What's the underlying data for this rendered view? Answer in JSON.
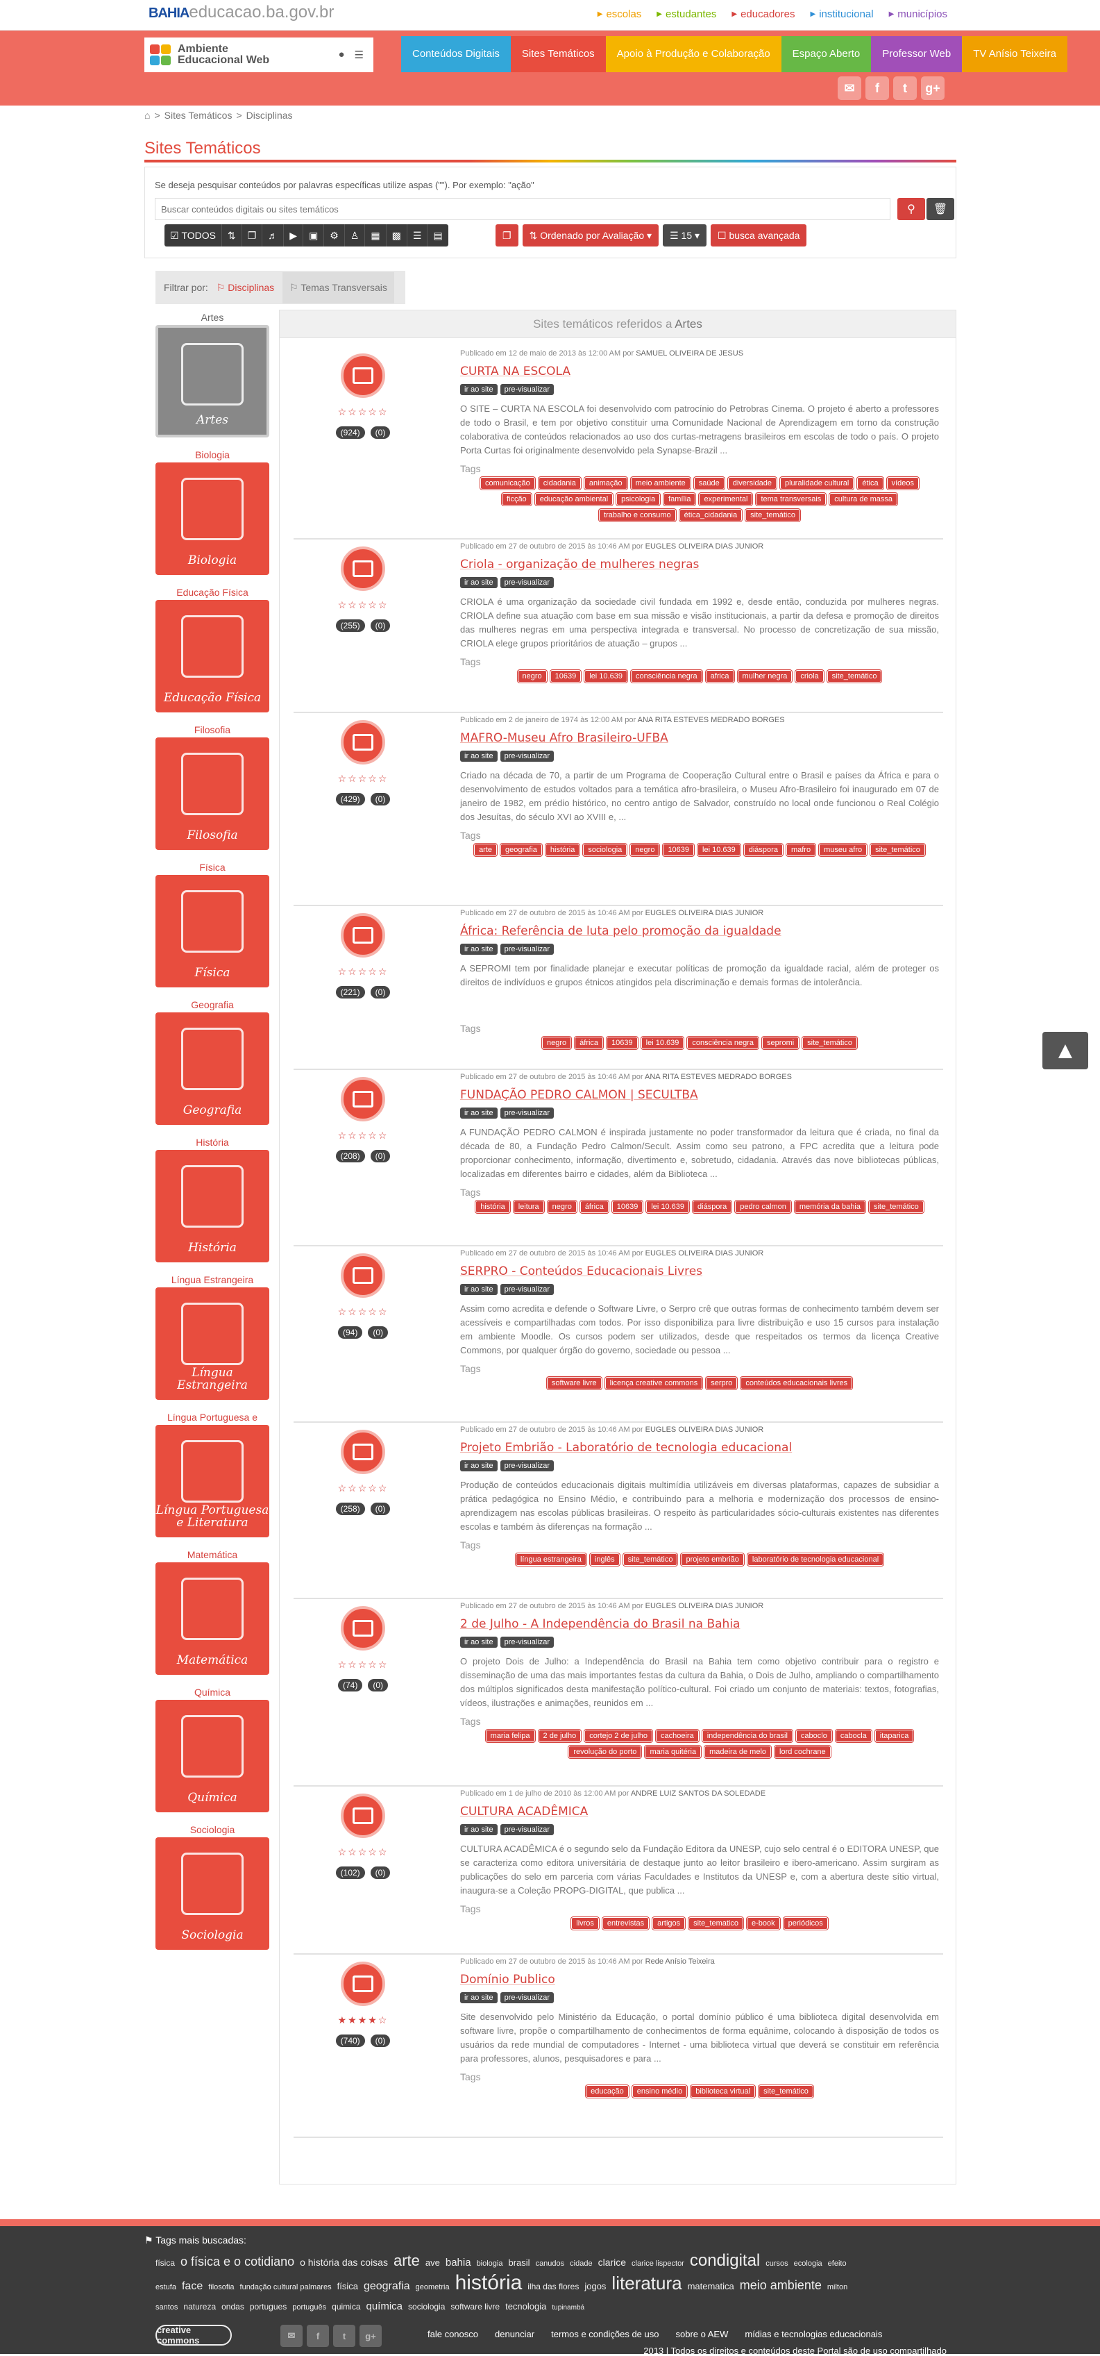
{
  "top": {
    "logo_bahia": "BAHIA",
    "logo_domain": "educacao.ba.gov.br",
    "links": [
      {
        "label": "escolas",
        "color": "#f0a000"
      },
      {
        "label": "estudantes",
        "color": "#7cb800"
      },
      {
        "label": "educadores",
        "color": "#d6423d"
      },
      {
        "label": "institucional",
        "color": "#2f8fd6"
      },
      {
        "label": "municípios",
        "color": "#8c52b8"
      }
    ]
  },
  "header": {
    "brand_line1": "Ambiente",
    "brand_line2": "Educacional Web",
    "nav": [
      {
        "label": "Conteúdos Digitais",
        "color": "#33a7d9"
      },
      {
        "label": "Sites Temáticos",
        "color": "#e84d3e"
      },
      {
        "label": "Apoio à Produção e Colaboração",
        "color": "#f5b400"
      },
      {
        "label": "Espaço Aberto",
        "color": "#67b846"
      },
      {
        "label": "Professor Web",
        "color": "#a14fb8"
      },
      {
        "label": "TV Anísio Teixeira",
        "color": "#f0a000"
      }
    ],
    "socials": [
      "✉",
      "f",
      "t",
      "g+"
    ]
  },
  "breadcrumb": [
    "⌂",
    ">",
    "Sites Temáticos",
    ">",
    "Disciplinas"
  ],
  "page_title": "Sites Temáticos",
  "search": {
    "hint": "Se deseja pesquisar conteúdos por palavras específicas utilize aspas (\"\"). Por exemplo: \"ação\"",
    "placeholder": "Buscar conteúdos digitais ou sites temáticos",
    "types_all": "TODOS",
    "order_label": "Ordenado por Avaliação",
    "per_page": "15",
    "advanced": "busca avançada"
  },
  "filter": {
    "label": "Filtrar por:",
    "opt1": "Disciplinas",
    "opt2": "Temas Transversais"
  },
  "subjects": [
    {
      "label": "Artes",
      "card": "Artes"
    },
    {
      "label": "Biologia",
      "card": "Biologia"
    },
    {
      "label": "Educação Física",
      "card": "Educação Física"
    },
    {
      "label": "Filosofia",
      "card": "Filosofia"
    },
    {
      "label": "Física",
      "card": "Física"
    },
    {
      "label": "Geografia",
      "card": "Geografia"
    },
    {
      "label": "História",
      "card": "História"
    },
    {
      "label": "Língua Estrangeira",
      "card": "Língua Estrangeira"
    },
    {
      "label": "Língua Portuguesa e Literatura",
      "card": "Língua Portuguesa e Literatura"
    },
    {
      "label": "Matemática",
      "card": "Matemática"
    },
    {
      "label": "Química",
      "card": "Química"
    },
    {
      "label": "Sociologia",
      "card": "Sociologia"
    }
  ],
  "content_head": {
    "prefix": "Sites temáticos referidos a",
    "subject": "Artes"
  },
  "buttons": {
    "site": "ir ao site",
    "preview": "pre-visualizar",
    "tags": "Tags"
  },
  "items": [
    {
      "meta": "Publicado em 12 de maio de 2013 às 12:00 AM por",
      "author": "SAMUEL OLIVEIRA DE JESUS",
      "title": "CURTA NA ESCOLA",
      "stars": "☆☆☆☆☆",
      "views": "(924)",
      "comments": "(0)",
      "desc": "O SITE – CURTA NA ESCOLA foi desenvolvido com patrocínio do Petrobras Cinema. O projeto é aberto a professores de todo o Brasil, e tem por objetivo constituir uma Comunidade Nacional de Aprendizagem em torno da construção colaborativa de conteúdos relacionados ao uso dos curtas-metragens brasileiros em escolas de todo o país. O projeto Porta Curtas foi originalmente desenvolvido pela Synapse-Brazil ...",
      "tags": [
        "comunicação",
        "cidadania",
        "animação",
        "meio ambiente",
        "saúde",
        "diversidade",
        "pluralidade cultural",
        "ética",
        "vídeos",
        "ficção",
        "educação ambiental",
        "psicologia",
        "família",
        "experimental",
        "tema transversais",
        "cultura de massa",
        "trabalho e consumo",
        "ética_cidadania",
        "site_temático"
      ]
    },
    {
      "meta": "Publicado em 27 de outubro de 2015 às 10:46 AM por",
      "author": "EUGLES OLIVEIRA DIAS JUNIOR",
      "title": "Criola - organização de mulheres negras",
      "stars": "☆☆☆☆☆",
      "views": "(255)",
      "comments": "(0)",
      "desc": "CRIOLA é uma organização da sociedade civil fundada em 1992 e, desde então, conduzida por mulheres negras. CRIOLA define sua atuação com base em sua missão e visão institucionais, a partir da defesa e promoção de direitos das mulheres negras em uma perspectiva integrada e transversal. No processo de concretização de sua missão, CRIOLA elege grupos prioritários de atuação – grupos ...",
      "tags": [
        "negro",
        "10639",
        "lei 10.639",
        "consciência negra",
        "africa",
        "mulher negra",
        "criola",
        "site_temático"
      ]
    },
    {
      "meta": "Publicado em 2 de janeiro de 1974 às 12:00 AM por",
      "author": "ANA RITA ESTEVES MEDRADO BORGES",
      "title": "MAFRO-Museu Afro Brasileiro-UFBA",
      "stars": "☆☆☆☆☆",
      "views": "(429)",
      "comments": "(0)",
      "desc": "Criado na década de 70, a partir de um Programa de Cooperação Cultural entre o Brasil e países da África e para o desenvolvimento de estudos voltados para a temática afro-brasileira, o Museu Afro-Brasileiro foi inaugurado em 07 de janeiro de 1982, em prédio histórico, no centro antigo de Salvador, construído no local onde funcionou o Real Colégio dos Jesuítas, do século XVI ao XVIII e, ...",
      "tags": [
        "arte",
        "geografia",
        "história",
        "sociologia",
        "negro",
        "10639",
        "lei 10.639",
        "diáspora",
        "mafro",
        "museu afro",
        "site_temático"
      ]
    },
    {
      "meta": "Publicado em 27 de outubro de 2015 às 10:46 AM por",
      "author": "EUGLES OLIVEIRA DIAS JUNIOR",
      "title": "África: Referência de luta pelo promoção da igualdade",
      "stars": "☆☆☆☆☆",
      "views": "(221)",
      "comments": "(0)",
      "desc": "A SEPROMI tem por finalidade planejar e executar políticas de promoção da igualdade racial, além de proteger os direitos de indivíduos e grupos étnicos atingidos pela discriminação e demais formas de intolerância.",
      "tags": [
        "negro",
        "áfrica",
        "10639",
        "lei 10.639",
        "consciência negra",
        "sepromi",
        "site_temático"
      ]
    },
    {
      "meta": "Publicado em 27 de outubro de 2015 às 10:46 AM por",
      "author": "ANA RITA ESTEVES MEDRADO BORGES",
      "title": "FUNDAÇÃO PEDRO CALMON | SECULTBA",
      "stars": "☆☆☆☆☆",
      "views": "(208)",
      "comments": "(0)",
      "desc": "A FUNDAÇÃO PEDRO CALMON é inspirada justamente no poder transformador da leitura que é criada, no final da década de 80, a Fundação Pedro Calmon/Secult. Assim como seu patrono, a FPC acredita que a leitura pode proporcionar conhecimento, informação, divertimento e, sobretudo, cidadania. Através das nove bibliotecas públicas, localizadas em diferentes bairro e cidades, além da Biblioteca ...",
      "tags": [
        "história",
        "leitura",
        "negro",
        "áfrica",
        "10639",
        "lei 10.639",
        "diáspora",
        "pedro calmon",
        "memória da bahia",
        "site_temático"
      ]
    },
    {
      "meta": "Publicado em 27 de outubro de 2015 às 10:46 AM por",
      "author": "EUGLES OLIVEIRA DIAS JUNIOR",
      "title": "SERPRO - Conteúdos Educacionais Livres",
      "stars": "☆☆☆☆☆",
      "views": "(94)",
      "comments": "(0)",
      "desc": "Assim como acredita e defende o Software Livre, o Serpro crê que outras formas de conhecimento também devem ser acessíveis e compartilhadas com todos. Por isso disponibiliza para livre distribuição e uso 15 cursos para instalação em ambiente Moodle. Os cursos podem ser utilizados, desde que respeitados os termos da licença Creative Commons, por qualquer órgão do governo, sociedade ou pessoa ...",
      "tags": [
        "software livre",
        "licença creative commons",
        "serpro",
        "conteúdos educacionais livres"
      ]
    },
    {
      "meta": "Publicado em 27 de outubro de 2015 às 10:46 AM por",
      "author": "EUGLES OLIVEIRA DIAS JUNIOR",
      "title": "Projeto Embrião - Laboratório de tecnologia educacional",
      "stars": "☆☆☆☆☆",
      "views": "(258)",
      "comments": "(0)",
      "desc": "Produção de conteúdos educacionais digitais multimídia utilizáveis em diversas plataformas, capazes de subsidiar a prática pedagógica no Ensino Médio, e contribuindo para a melhoria e modernização dos processos de ensino-aprendizagem nas escolas públicas brasileiras. O respeito às particularidades sócio-culturais existentes nas diferentes escolas e também às diferenças na formação ...",
      "tags": [
        "língua estrangeira",
        "inglês",
        "site_temático",
        "projeto embrião",
        "laboratório de tecnologia educacional"
      ]
    },
    {
      "meta": "Publicado em 27 de outubro de 2015 às 10:46 AM por",
      "author": "EUGLES OLIVEIRA DIAS JUNIOR",
      "title": "2 de Julho - A Independência do Brasil na Bahia",
      "stars": "☆☆☆☆☆",
      "views": "(74)",
      "comments": "(0)",
      "desc": "O projeto Dois de Julho: a Independência do Brasil na Bahia tem como objetivo contribuir para o registro e disseminação de uma das mais importantes festas da cultura da Bahia, o Dois de Julho, ampliando o compartilhamento dos múltiplos significados desta manifestação político-cultural. Foi criado um conjunto de materiais: textos, fotografias, vídeos, ilustrações e animações, reunidos em ...",
      "tags": [
        "maria felipa",
        "2 de julho",
        "cortejo 2 de julho",
        "cachoeira",
        "independência do brasil",
        "caboclo",
        "cabocla",
        "itaparica",
        "revolução do porto",
        "maria quitéria",
        "madeira de melo",
        "lord cochrane"
      ]
    },
    {
      "meta": "Publicado em 1 de julho de 2010 às 12:00 AM por",
      "author": "ANDRE LUIZ SANTOS DA SOLEDADE",
      "title": "CULTURA ACADÊMICA",
      "stars": "☆☆☆☆☆",
      "views": "(102)",
      "comments": "(0)",
      "desc": "CULTURA ACADÊMICA é o segundo selo da Fundação Editora da UNESP, cujo selo central é o EDITORA UNESP, que se caracteriza como editora universitária de destaque junto ao leitor brasileiro e ibero-americano. Assim surgiram as publicações do selo em parceria com várias Faculdades e Institutos da UNESP e, com a abertura deste sítio virtual, inaugura-se a Coleção PROPG-DIGITAL, que publica ...",
      "tags": [
        "livros",
        "entrevistas",
        "artigos",
        "site_tematico",
        "e-book",
        "periódicos"
      ]
    },
    {
      "meta": "Publicado em 27 de outubro de 2015 às 10:46 AM por",
      "author": "Rede Anísio Teixeira",
      "title": "Domínio Publico",
      "stars": "★★★★☆",
      "views": "(740)",
      "comments": "(0)",
      "desc": "Site desenvolvido pelo Ministério da Educação, o portal domínio público é uma biblioteca digital desenvolvida em software livre, propõe o compartilhamento de conhecimentos de forma equânime, colocando à disposição de todos os usuários da rede mundial de computadores - Internet - uma biblioteca virtual que deverá se constituir em referência para professores, alunos, pesquisadores e para ...",
      "tags": [
        "educação",
        "ensino médio",
        "biblioteca virtual",
        "site_temático"
      ]
    }
  ],
  "footer": {
    "title": "Tags mais buscadas:",
    "cloud": [
      {
        "t": "física",
        "s": 12
      },
      {
        "t": "o física e o cotidiano",
        "s": 18
      },
      {
        "t": "o história das coisas",
        "s": 14
      },
      {
        "t": "arte",
        "s": 22
      },
      {
        "t": "ave",
        "s": 13
      },
      {
        "t": "bahia",
        "s": 15
      },
      {
        "t": "biologia",
        "s": 11
      },
      {
        "t": "brasil",
        "s": 13
      },
      {
        "t": "canudos",
        "s": 11
      },
      {
        "t": "cidade",
        "s": 11
      },
      {
        "t": "clarice",
        "s": 14
      },
      {
        "t": "clarice lispector",
        "s": 11
      },
      {
        "t": "condigital",
        "s": 24
      },
      {
        "t": "cursos",
        "s": 11
      },
      {
        "t": "ecologia",
        "s": 11
      },
      {
        "t": "efeito estufa",
        "s": 11
      },
      {
        "t": "face",
        "s": 16
      },
      {
        "t": "filosofia",
        "s": 11
      },
      {
        "t": "fundação cultural palmares",
        "s": 11
      },
      {
        "t": "física",
        "s": 13
      },
      {
        "t": "geografia",
        "s": 16
      },
      {
        "t": "geometria",
        "s": 11
      },
      {
        "t": "história",
        "s": 30
      },
      {
        "t": "ilha das flores",
        "s": 12
      },
      {
        "t": "jogos",
        "s": 13
      },
      {
        "t": "literatura",
        "s": 26
      },
      {
        "t": "matematica",
        "s": 13
      },
      {
        "t": "meio ambiente",
        "s": 18
      },
      {
        "t": "milton santos",
        "s": 11
      },
      {
        "t": "natureza",
        "s": 12
      },
      {
        "t": "ondas",
        "s": 12
      },
      {
        "t": "portugues",
        "s": 12
      },
      {
        "t": "português",
        "s": 11
      },
      {
        "t": "quimica",
        "s": 12
      },
      {
        "t": "química",
        "s": 15
      },
      {
        "t": "sociologia",
        "s": 12
      },
      {
        "t": "software livre",
        "s": 12
      },
      {
        "t": "tecnologia",
        "s": 13
      },
      {
        "t": "tupinambá",
        "s": 10
      }
    ],
    "cc": "creative commons",
    "links": [
      "fale conosco",
      "denunciar",
      "termos e condições de uso",
      "sobre o AEW",
      "mídias e tecnologias educacionais"
    ],
    "copyright": "2013 | Todos os direitos e conteúdos deste Portal são de uso compartilhado"
  },
  "totop": "▲"
}
